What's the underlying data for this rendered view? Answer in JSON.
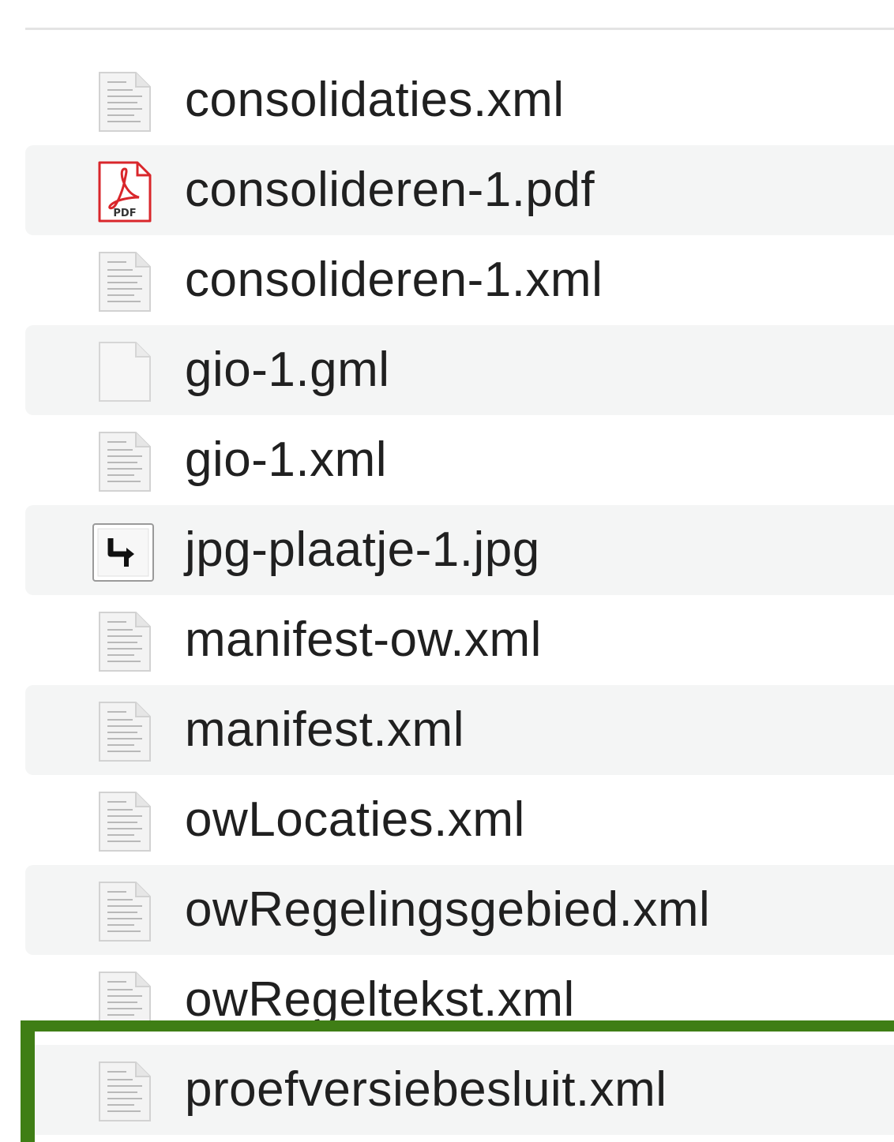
{
  "files": [
    {
      "name": "consolidaties.xml",
      "icon": "xml-file-icon"
    },
    {
      "name": "consolideren-1.pdf",
      "icon": "pdf-file-icon",
      "badge": "PDF"
    },
    {
      "name": "consolideren-1.xml",
      "icon": "xml-file-icon"
    },
    {
      "name": "gio-1.gml",
      "icon": "blank-file-icon"
    },
    {
      "name": "gio-1.xml",
      "icon": "xml-file-icon"
    },
    {
      "name": "jpg-plaatje-1.jpg",
      "icon": "image-file-icon"
    },
    {
      "name": "manifest-ow.xml",
      "icon": "xml-file-icon"
    },
    {
      "name": "manifest.xml",
      "icon": "xml-file-icon"
    },
    {
      "name": "owLocaties.xml",
      "icon": "xml-file-icon"
    },
    {
      "name": "owRegelingsgebied.xml",
      "icon": "xml-file-icon"
    },
    {
      "name": "owRegeltekst.xml",
      "icon": "xml-file-icon"
    },
    {
      "name": "proefversiebesluit.xml",
      "icon": "xml-file-icon"
    }
  ],
  "colors": {
    "row_alt_background": "#f4f5f5",
    "highlight_border": "#3f7e15",
    "pdf_red": "#d9262b",
    "text": "#202020"
  }
}
